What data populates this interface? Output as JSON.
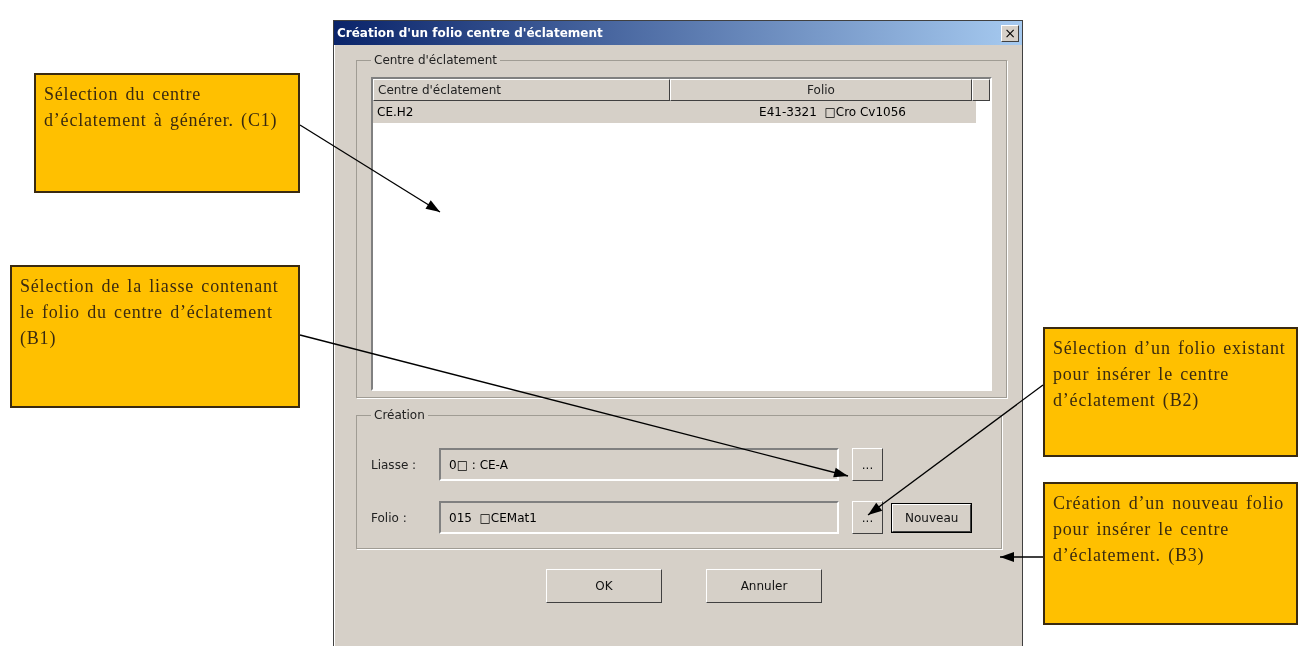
{
  "dialog": {
    "title": "Création d'un folio centre d'éclatement",
    "close_label": "×",
    "list_group": {
      "label": "Centre d'éclatement",
      "columns": [
        "Centre d'éclatement",
        "Folio"
      ],
      "rows": [
        {
          "cells": [
            "CE.H2",
            "E41-3321  □Cro Cv1056"
          ],
          "selected": true
        }
      ]
    },
    "creation_group": {
      "label": "Création",
      "fields": [
        {
          "label": "Liasse :",
          "value": "0□ : CE-A",
          "browse": "..."
        },
        {
          "label": "Folio :",
          "value": "015  □CEMat1",
          "browse": "...",
          "extra": "Nouveau"
        }
      ]
    },
    "buttons": [
      "OK",
      "Annuler"
    ]
  },
  "callouts": [
    {
      "text": "Sélection du centre d’éclatement à générer. (C1)"
    },
    {
      "text": "Sélection de la liasse contenant le folio du centre d’éclatement (B1)"
    },
    {
      "text": "Sélection d’un folio existant pour insérer le centre d’éclatement (B2)"
    },
    {
      "text": "Création d’un nouveau folio pour insérer le centre d’éclatement. (B3)"
    }
  ]
}
